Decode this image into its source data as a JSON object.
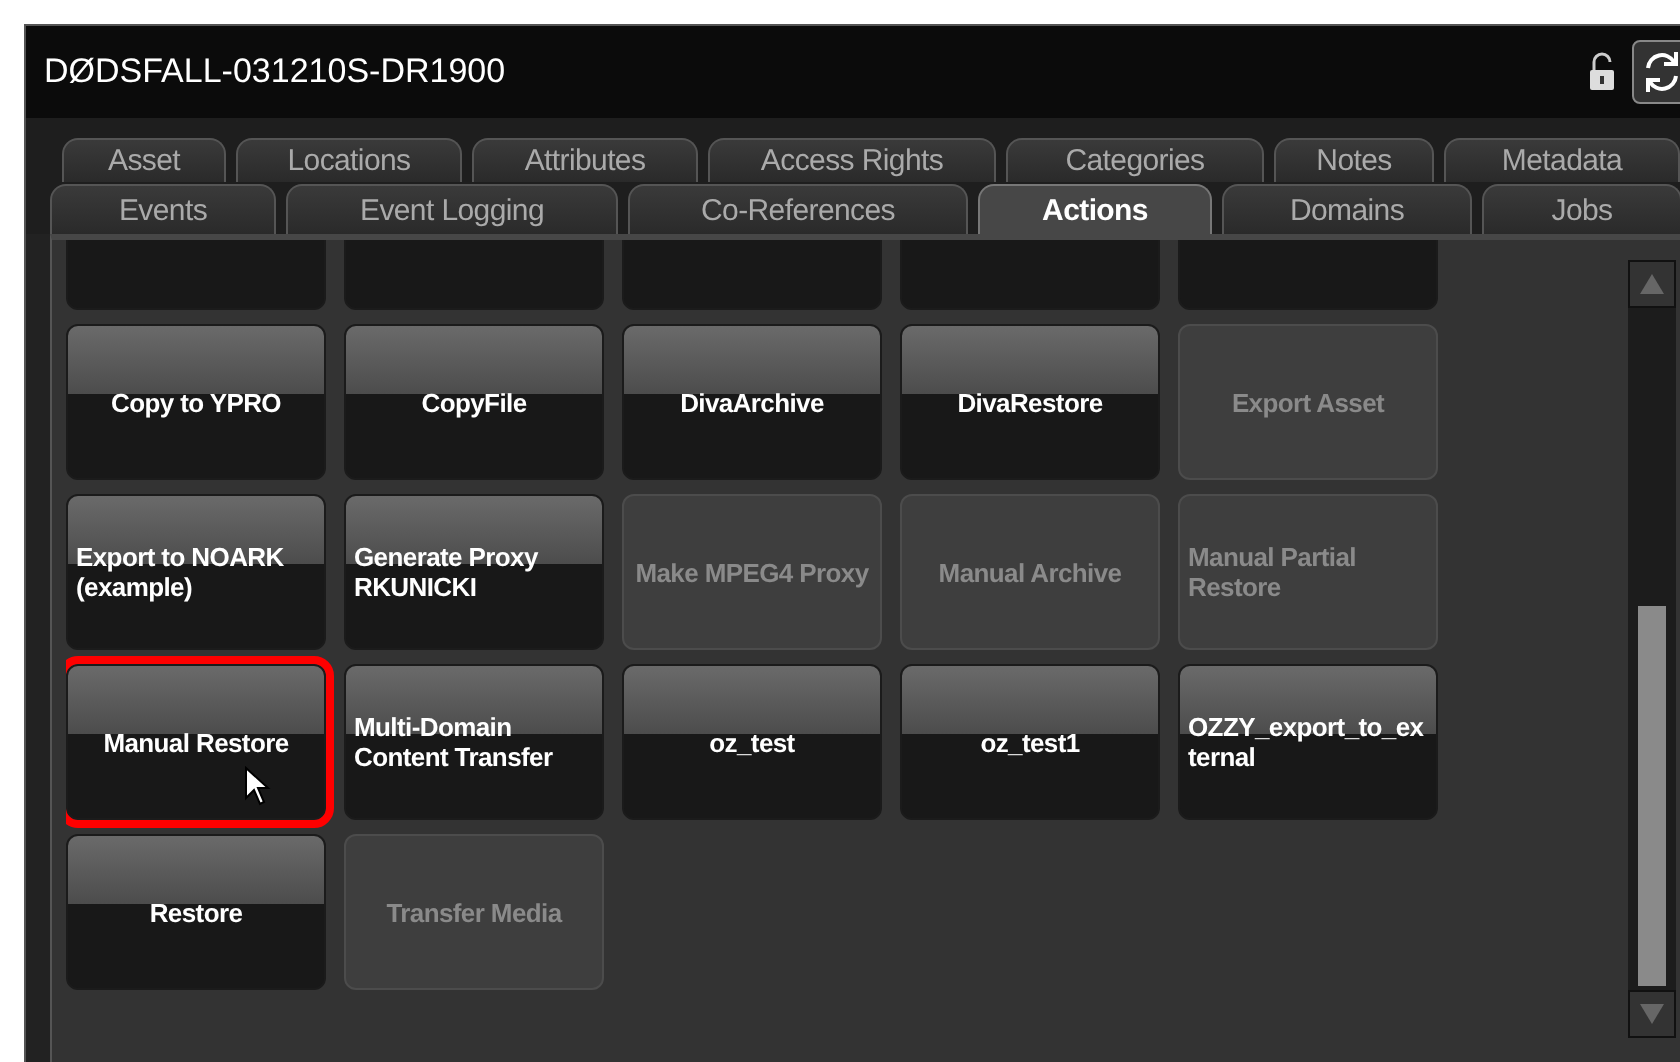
{
  "window": {
    "title": "DØDSFALL-031210S-DR1900"
  },
  "tab_rows": [
    {
      "tabs": [
        {
          "label": "Asset",
          "selected": false
        },
        {
          "label": "Locations",
          "selected": false
        },
        {
          "label": "Attributes",
          "selected": false
        },
        {
          "label": "Access Rights",
          "selected": false
        },
        {
          "label": "Categories",
          "selected": false
        },
        {
          "label": "Notes",
          "selected": false
        },
        {
          "label": "Metadata",
          "selected": false
        }
      ]
    },
    {
      "tabs": [
        {
          "label": "Events",
          "selected": false
        },
        {
          "label": "Event Logging",
          "selected": false
        },
        {
          "label": "Co-References",
          "selected": false
        },
        {
          "label": "Actions",
          "selected": true
        },
        {
          "label": "Domains",
          "selected": false
        },
        {
          "label": "Jobs",
          "selected": false
        }
      ]
    }
  ],
  "actions": [
    {
      "disabled": false,
      "selected": false
    },
    {
      "disabled": false,
      "selected": false
    },
    {
      "disabled": false,
      "selected": false
    },
    {
      "disabled": false,
      "selected": false
    },
    {
      "disabled": false,
      "selected": false
    },
    {
      "label": "Copy to YPRO",
      "disabled": false,
      "selected": false
    },
    {
      "label": "CopyFile",
      "disabled": false,
      "selected": false
    },
    {
      "label": "DivaArchive",
      "disabled": false,
      "selected": false
    },
    {
      "label": "DivaRestore",
      "disabled": false,
      "selected": false
    },
    {
      "label": "Export Asset",
      "disabled": true,
      "selected": false
    },
    {
      "label": "Export to NOARK (example)",
      "disabled": false,
      "selected": false
    },
    {
      "label": "Generate Proxy RKUNICKI",
      "disabled": false,
      "selected": false
    },
    {
      "label": "Make MPEG4 Proxy",
      "disabled": true,
      "selected": false
    },
    {
      "label": "Manual Archive",
      "disabled": true,
      "selected": false
    },
    {
      "label": "Manual Partial Restore",
      "disabled": true,
      "selected": false
    },
    {
      "label": "Manual Restore",
      "disabled": false,
      "selected": true
    },
    {
      "label": "Multi-Domain Content Transfer",
      "disabled": false,
      "selected": false
    },
    {
      "label": "oz_test",
      "disabled": false,
      "selected": false
    },
    {
      "label": "oz_test1",
      "disabled": false,
      "selected": false
    },
    {
      "label": "OZZY_export_to_external",
      "disabled": false,
      "selected": false
    },
    {
      "label": "Restore",
      "disabled": false,
      "selected": false
    },
    {
      "label": "Transfer Media",
      "disabled": true,
      "selected": false
    }
  ]
}
